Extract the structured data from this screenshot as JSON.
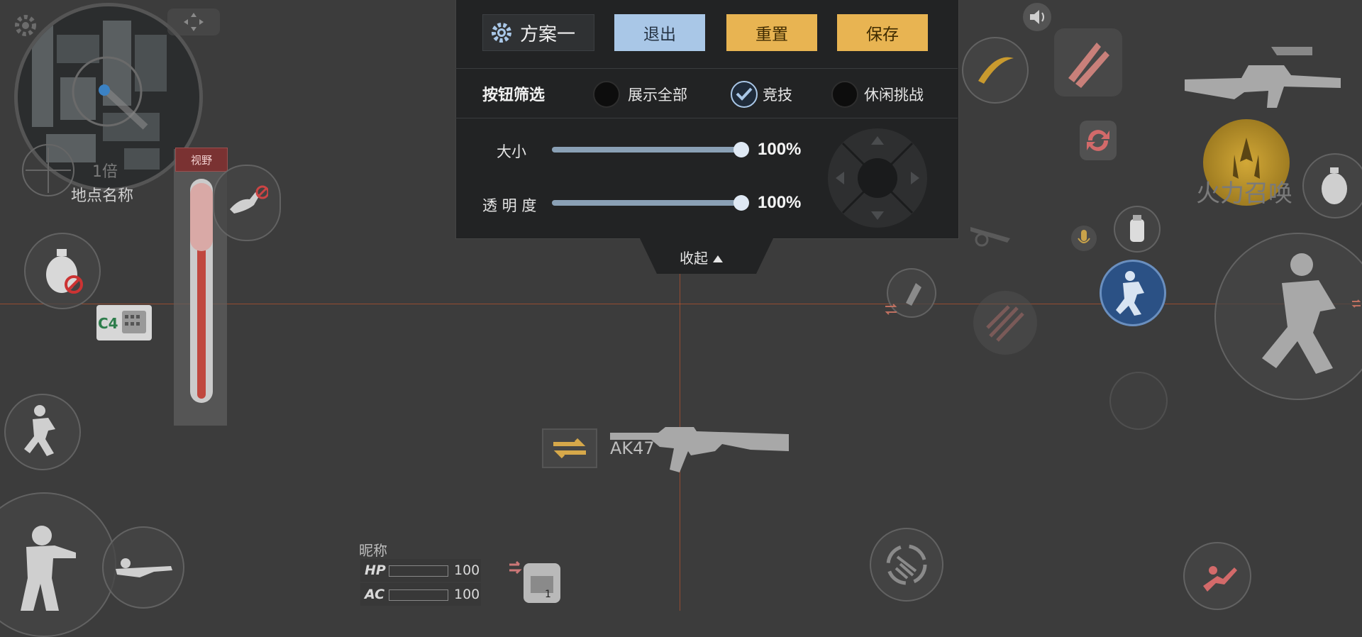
{
  "panel": {
    "scheme_name": "方案一",
    "exit_label": "退出",
    "reset_label": "重置",
    "save_label": "保存",
    "filter_title": "按钮筛选",
    "filters": [
      {
        "label": "展示全部",
        "checked": false
      },
      {
        "label": "竞技",
        "checked": true
      },
      {
        "label": "休闲挑战",
        "checked": false
      }
    ],
    "size_label": "大小",
    "size_value": "100%",
    "opacity_label": "透 明 度",
    "opacity_value": "100%",
    "collapse_label": "收起"
  },
  "hud": {
    "minimap_label": "地点名称",
    "minimap_scale": "1倍",
    "view_label": "视野",
    "c4_label": "C4",
    "weapon_name": "AK47",
    "nickname": "昵称",
    "hp_label": "HP",
    "hp_value": "100",
    "ac_label": "AC",
    "ac_value": "100",
    "fire_support_label": "火力召唤",
    "grenade_count": "1"
  },
  "colors": {
    "background": "#3c3c3c",
    "panel": "#222324",
    "exit_button": "#a9c7e7",
    "action_button": "#e8b452",
    "guide_line": "#dc5a28"
  }
}
